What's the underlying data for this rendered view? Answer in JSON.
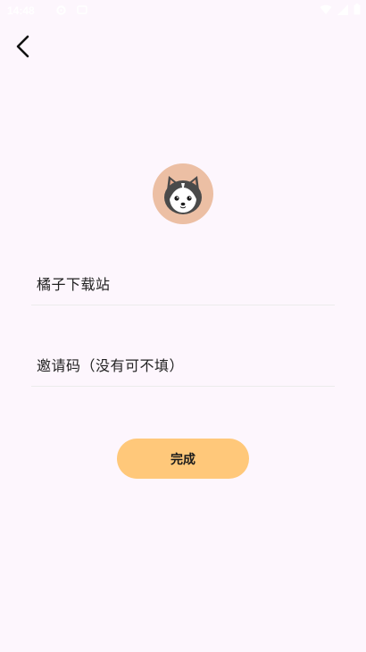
{
  "status_bar": {
    "time": "14:48",
    "icons": [
      "gear-icon",
      "notification-icon",
      "wifi-icon",
      "signal-icon",
      "battery-icon"
    ]
  },
  "header": {
    "back_icon": "chevron-left-icon"
  },
  "profile": {
    "avatar_icon": "husky-dog-avatar"
  },
  "form": {
    "nickname_value": "橘子下载站",
    "invite_placeholder": "邀请码（没有可不填）"
  },
  "actions": {
    "done_label": "完成"
  },
  "colors": {
    "background": "#fdf6fd",
    "avatar_bg": "#ecbfa4",
    "button_bg": "#ffc87a"
  }
}
